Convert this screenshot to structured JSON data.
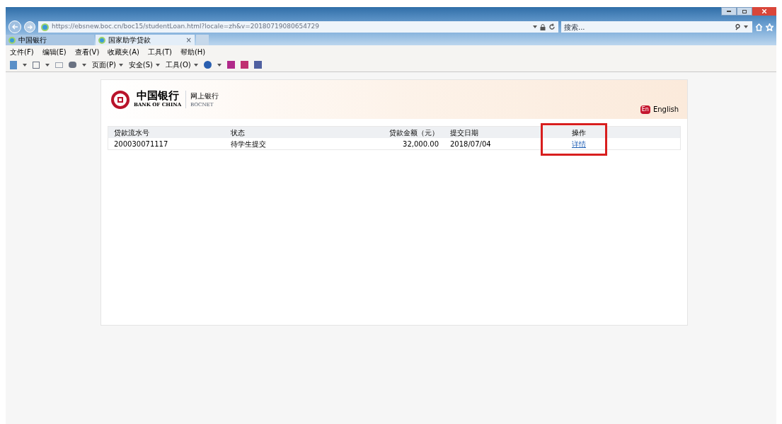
{
  "browser": {
    "url": "https://ebsnew.boc.cn/boc15/studentLoan.html?locale=zh&v=20180719080654729",
    "search": {
      "placeholder": "搜索..."
    },
    "tabs": [
      {
        "label": "中国银行",
        "selected": false
      },
      {
        "label": "国家助学贷款",
        "selected": true,
        "close": "×"
      }
    ],
    "menu": [
      "文件(F)",
      "编辑(E)",
      "查看(V)",
      "收藏夹(A)",
      "工具(T)",
      "帮助(H)"
    ],
    "toolbar": [
      "页面(P)",
      "安全(S)",
      "工具(O)"
    ]
  },
  "page": {
    "logo": {
      "name_cn": "中国银行",
      "name_en": "BANK OF CHINA",
      "service_cn": "网上银行",
      "service_en": "BOCNET"
    },
    "language": {
      "badge": "En",
      "label": "English"
    },
    "table": {
      "columns": [
        "贷款流水号",
        "状态",
        "贷款金额（元）",
        "提交日期",
        "操作"
      ],
      "rows": [
        {
          "cells": [
            "200030071117",
            "待学生提交",
            "32,000.00",
            "2018/07/04"
          ],
          "action": "详情"
        }
      ]
    },
    "highlight": true
  }
}
